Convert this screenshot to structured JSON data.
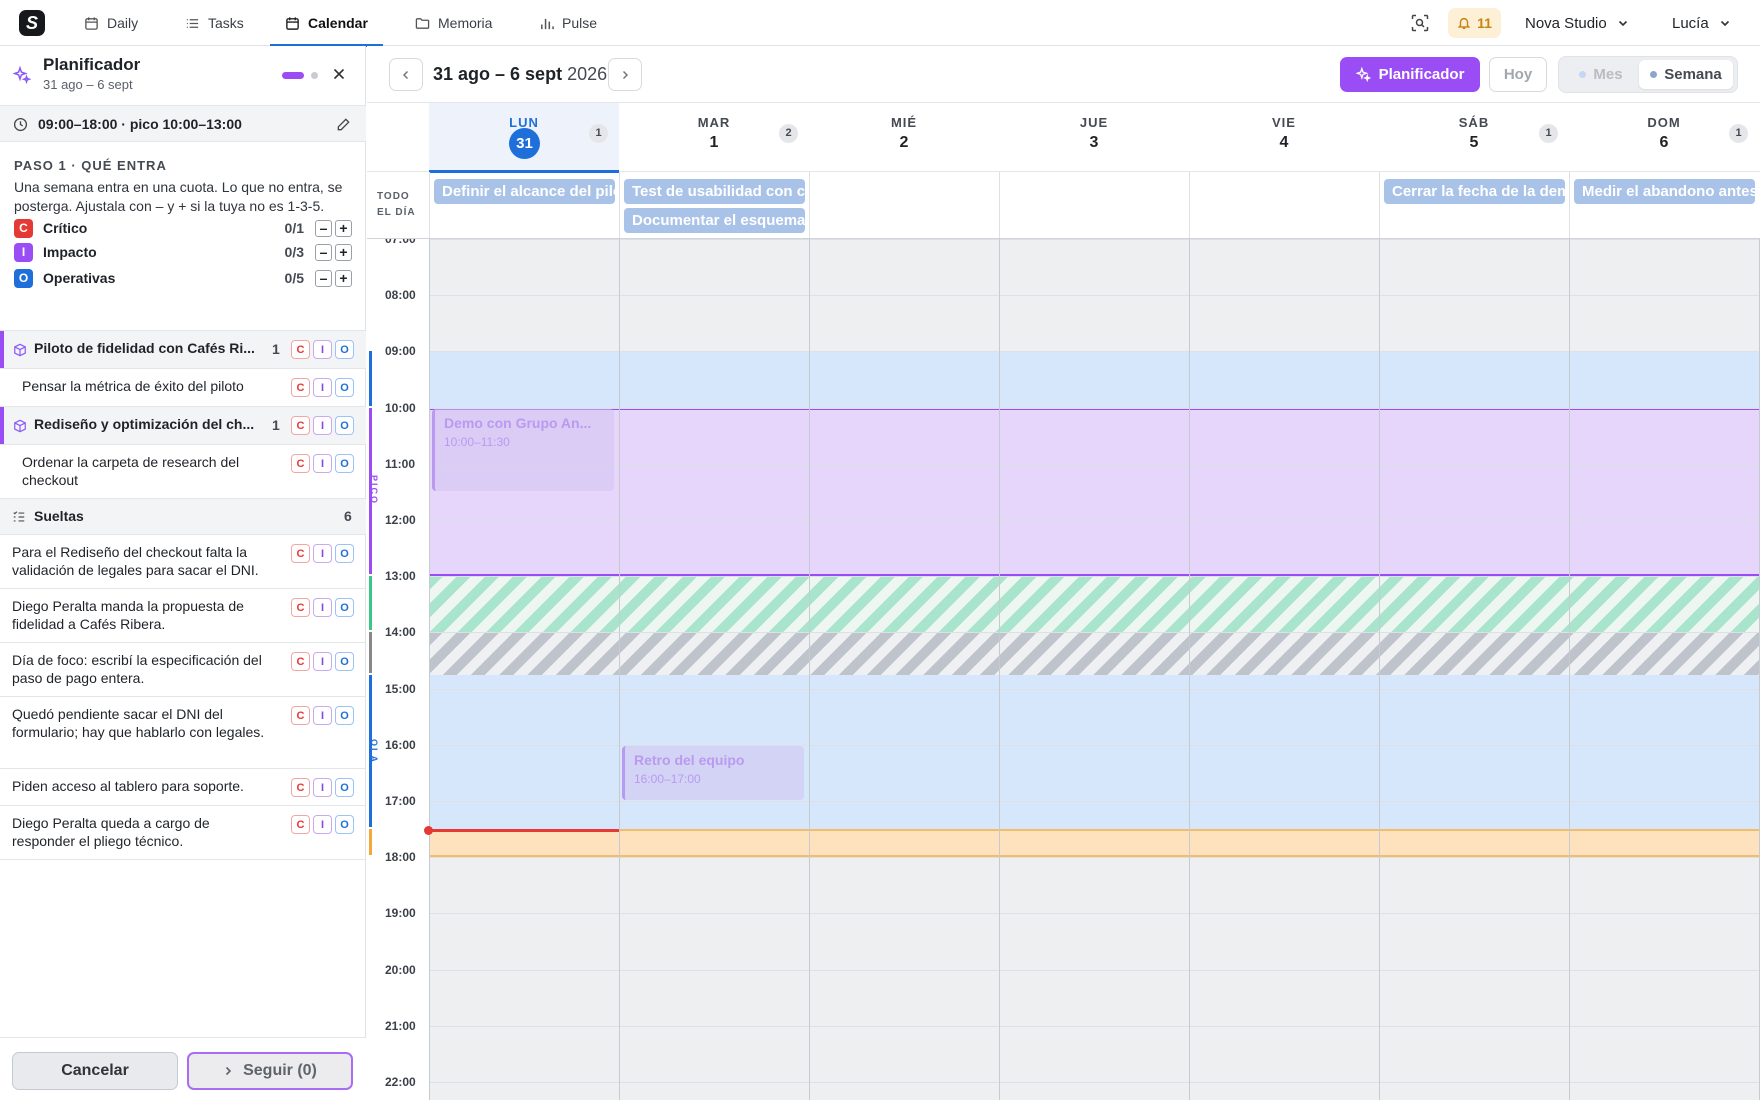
{
  "nav": {
    "logo_letter": "S",
    "tabs": [
      {
        "label": "Daily",
        "icon": "calendar-icon"
      },
      {
        "label": "Tasks",
        "icon": "list-icon"
      },
      {
        "label": "Calendar",
        "icon": "calendar-icon",
        "active": true
      },
      {
        "label": "Memoria",
        "icon": "folder-icon"
      },
      {
        "label": "Pulse",
        "icon": "bar-chart-icon"
      }
    ],
    "notifications": "11",
    "workspace": "Nova Studio",
    "user": "Lucía"
  },
  "planner": {
    "title": "Planificador",
    "subtitle": "31 ago – 6 sept",
    "hours": "09:00–18:00 · pico 10:00–13:00",
    "step_title": "PASO 1 · QUÉ ENTRA",
    "step_desc": "Una semana entra en una cuota. Lo que no entra, se posterga. Ajustala con – y + si la tuya no es 1-3-5.",
    "quotas": [
      {
        "letter": "C",
        "name": "Crítico",
        "count": "0/1",
        "color": "#e53935"
      },
      {
        "letter": "I",
        "name": "Impacto",
        "count": "0/3",
        "color": "#9b4df5"
      },
      {
        "letter": "O",
        "name": "Operativas",
        "count": "0/5",
        "color": "#1e6fd9"
      }
    ],
    "groups": [
      {
        "title": "Piloto de fidelidad con Cafés Ri...",
        "count": "1",
        "task": "Pensar la métrica de éxito del piloto"
      },
      {
        "title": "Rediseño y optimización del ch...",
        "count": "1",
        "task": "Ordenar la carpeta de research del checkout"
      }
    ],
    "loose_title": "Sueltas",
    "loose_count": "6",
    "loose": [
      "Para el Rediseño del checkout falta la validación de legales para sacar el DNI.",
      "Diego Peralta manda la propuesta de fidelidad a Cafés Ribera.",
      "Día de foco: escribí la especificación del paso de pago entera.",
      "Quedó pendiente sacar el DNI del formulario; hay que hablarlo con legales.",
      "Piden acceso al tablero para soporte.",
      "Diego Peralta queda a cargo de responder el pliego técnico."
    ],
    "cancel": "Cancelar",
    "next": "Seguir (0)"
  },
  "calendar": {
    "range_main": "31 ago – 6 sept",
    "range_year": "2026",
    "planner_btn": "Planificador",
    "today_btn": "Hoy",
    "view_month": "Mes",
    "view_week": "Semana",
    "allday_label_1": "TODO",
    "allday_label_2": "EL DÍA",
    "days": [
      {
        "name": "LUN",
        "date": "31",
        "count": "1",
        "today": true
      },
      {
        "name": "MAR",
        "date": "1",
        "count": "2"
      },
      {
        "name": "MIÉ",
        "date": "2",
        "count": ""
      },
      {
        "name": "JUE",
        "date": "3",
        "count": ""
      },
      {
        "name": "VIE",
        "date": "4",
        "count": ""
      },
      {
        "name": "SÁB",
        "date": "5",
        "count": "1"
      },
      {
        "name": "DOM",
        "date": "6",
        "count": "1"
      }
    ],
    "allday_events": [
      {
        "day": 0,
        "row": 0,
        "title": "Definir el alcance del piloto"
      },
      {
        "day": 1,
        "row": 0,
        "title": "Test de usabilidad con checkout"
      },
      {
        "day": 1,
        "row": 1,
        "title": "Documentar el esquema"
      },
      {
        "day": 5,
        "row": 0,
        "title": "Cerrar la fecha de la demo"
      },
      {
        "day": 6,
        "row": 0,
        "title": "Medir el abandono antes"
      }
    ],
    "hours": [
      "07:00",
      "08:00",
      "09:00",
      "10:00",
      "11:00",
      "12:00",
      "13:00",
      "14:00",
      "15:00",
      "16:00",
      "17:00",
      "18:00",
      "19:00",
      "20:00",
      "21:00",
      "22:00"
    ],
    "band_pico": "PICO",
    "band_ola": "OLA",
    "events": [
      {
        "day": 0,
        "start": 10.0,
        "end": 11.5,
        "title": "Demo con Grupo An...",
        "time": "10:00–11:30",
        "color": "#b99af0"
      },
      {
        "day": 1,
        "start": 16.0,
        "end": 17.0,
        "title": "Retro del equipo",
        "time": "16:00–17:00",
        "color": "#b99af0"
      }
    ],
    "colors": {
      "work": "#d6e6fb",
      "pico": "#e7d6fc",
      "green": "#a9e4cc",
      "gray": "#bfc3cc",
      "orange": "#fde2bd",
      "now": "#e53935",
      "accent": "#9b4df5",
      "blue": "#1e6fd9"
    }
  }
}
